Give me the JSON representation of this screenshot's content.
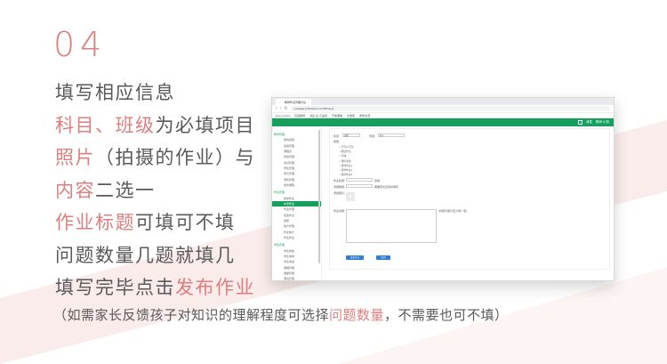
{
  "step_number": "04",
  "lines": [
    [
      {
        "t": "填写相应信息",
        "hl": false
      }
    ],
    [
      {
        "t": "科目、班级",
        "hl": true
      },
      {
        "t": "为必填项目",
        "hl": false
      }
    ],
    [
      {
        "t": "照片",
        "hl": true
      },
      {
        "t": "（拍摄的作业）与",
        "hl": false
      }
    ],
    [
      {
        "t": "内容",
        "hl": true
      },
      {
        "t": "二选一",
        "hl": false
      }
    ],
    [
      {
        "t": "作业标题",
        "hl": true
      },
      {
        "t": "可填可不填",
        "hl": false
      }
    ],
    [
      {
        "t": "问题数量几题就填几",
        "hl": false
      }
    ],
    [
      {
        "t": "填写完毕点击",
        "hl": false
      },
      {
        "t": "发布作业",
        "hl": true
      }
    ]
  ],
  "note": {
    "pre": "（如需家长反馈孩子对知识的理解程度可选择",
    "hl": "问题数量",
    "post": "，不需要也可不填）"
  },
  "colors": {
    "accent": "#e07d7d",
    "text": "#595959",
    "green": "#17a05d",
    "blue": "#2e7dd6"
  },
  "browser": {
    "tab_title": "教师作业管理平台",
    "url": "manager.ycloudcom.com/#/zuoye",
    "bookmarks": [
      "jnet.ymydos",
      "百度翻译",
      "书签·后·元品牌",
      "开放课堂",
      "文章库",
      "教学资源"
    ]
  },
  "header": {
    "items": [
      "消息",
      "教师·小张"
    ]
  },
  "sidebar": {
    "groups": [
      {
        "label": "教学管理",
        "items": [
          "我的班级",
          "班级管理",
          "课程表",
          "成绩管理",
          "考试管理",
          "学生管理",
          "家长管理",
          "通知管理",
          "我的课程"
        ]
      },
      {
        "label": "作业管理",
        "items": [
          "我的作业",
          "布置作业",
          "作业管理",
          "批改作业",
          "题库",
          "统计管理",
          "作业统计",
          "学生作业"
        ]
      },
      {
        "label": "学生管理",
        "items": [
          "学生档案",
          "学生考勤",
          "学生成绩",
          "课程管理",
          "课堂管理",
          "课后管理",
          "学校管理",
          "我的设置"
        ]
      }
    ],
    "active": "布置作业"
  },
  "form": {
    "subject_label": "科目：",
    "subject_value": "语文",
    "class_label": "年级：",
    "class_value": "初一",
    "type_label": "类型：",
    "radios": [
      "不可以不写",
      "朗读作业",
      "背诵",
      "课外阅读",
      "其他作业1",
      "其他作业2",
      "其他作业3"
    ],
    "title_label": "作业标题：",
    "title_hint": "选填",
    "qcount_label": "问题数量：",
    "qcount_hint": "需要家长反馈时填写",
    "photo_label": "添加照片：",
    "content_label": "作业内容：",
    "content_hint": "(内容与照片至少填一项)",
    "btn_preview": "发布作业",
    "btn_cancel": "取消"
  }
}
